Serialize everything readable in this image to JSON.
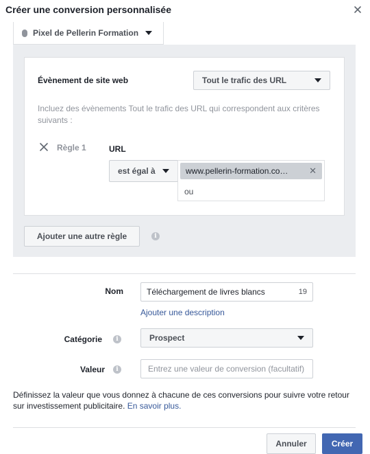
{
  "dialog": {
    "title": "Créer une conversion personnalisée",
    "close_icon": "close-icon"
  },
  "pixel": {
    "name": "Pixel de Pellerin Formation"
  },
  "rules": {
    "event_label": "Évènement de site web",
    "event_select": "Tout le trafic des URL",
    "help_text": "Incluez des évènements Tout le trafic des URL qui correspondent aux critères suivants :",
    "rule_label": "Règle 1",
    "field_label": "URL",
    "operator": "est égal à",
    "url_token": "www.pellerin-formation.co…",
    "or_text": "ou",
    "add_rule_button": "Ajouter une autre règle"
  },
  "form": {
    "name_label": "Nom",
    "name_value": "Téléchargement de livres blancs",
    "name_remaining": "19",
    "add_description_link": "Ajouter une description",
    "category_label": "Catégorie",
    "category_value": "Prospect",
    "value_label": "Valeur",
    "value_placeholder": "Entrez une valeur de conversion (facultatif)"
  },
  "footnote": {
    "text": "Définissez la valeur que vous donnez à chacune de ces conversions pour suivre votre retour sur investissement publicitaire. ",
    "link": "En savoir plus."
  },
  "buttons": {
    "cancel": "Annuler",
    "create": "Créer"
  },
  "colors": {
    "accent": "#4267b2",
    "link": "#365899",
    "panel_bg": "#ebedf0",
    "token_bg": "#ccd0d5"
  }
}
